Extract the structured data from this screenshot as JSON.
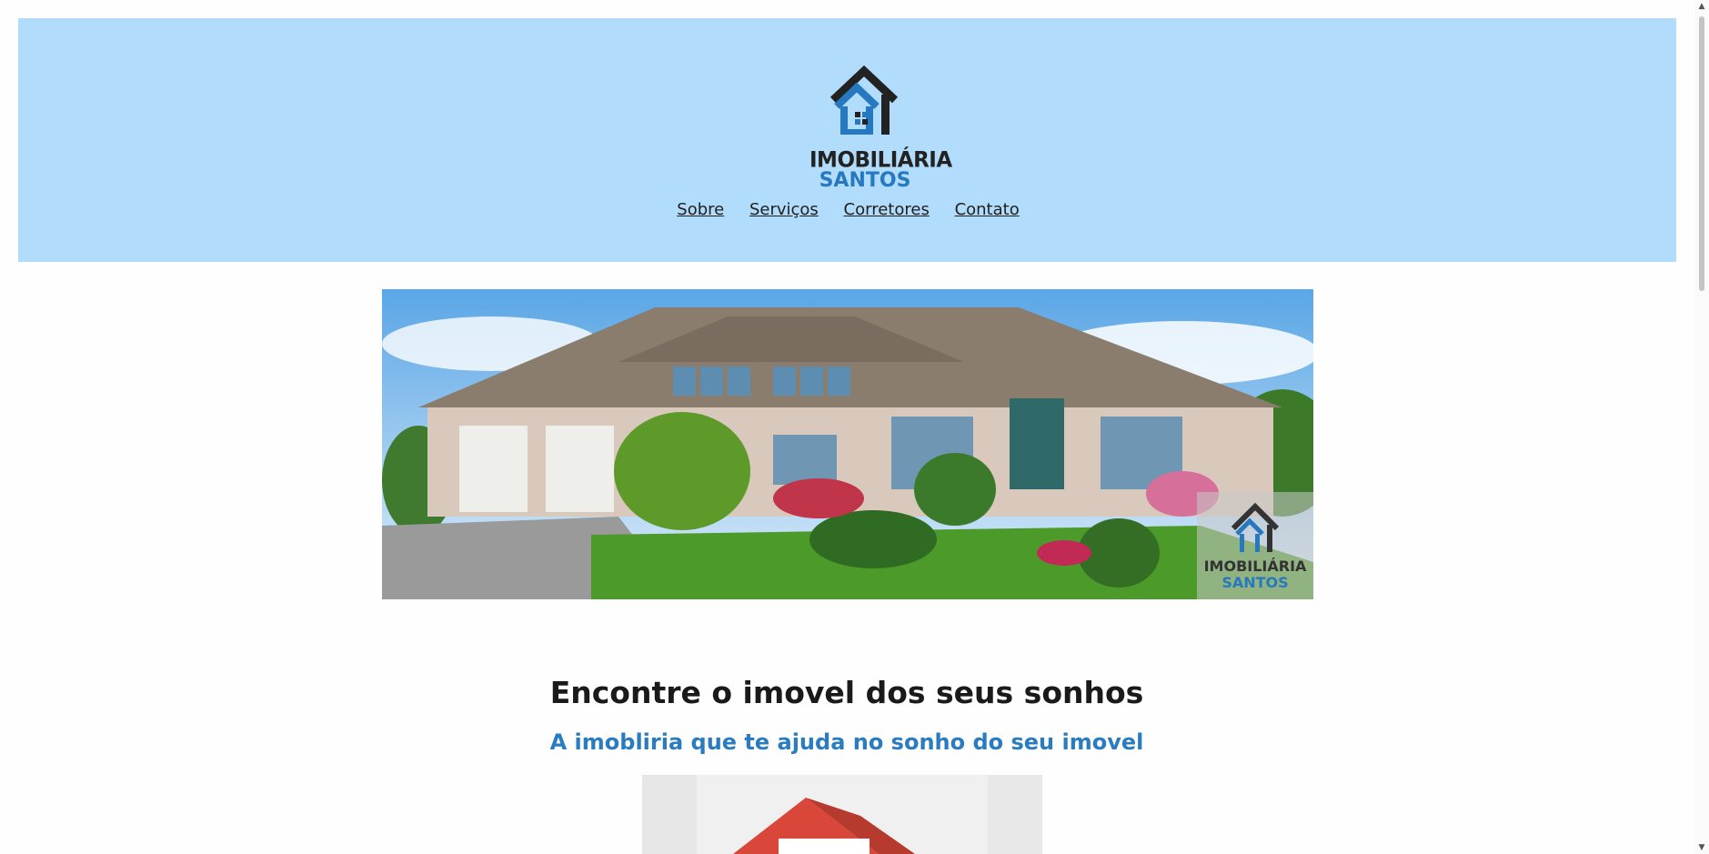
{
  "brand": {
    "line1": "IMOBILIÁRIA",
    "line2": "SANTOS",
    "colors": {
      "header_bg": "#b1dcfc",
      "accent_blue": "#2679bf",
      "dark": "#222222"
    }
  },
  "nav": {
    "items": [
      {
        "label": "Sobre"
      },
      {
        "label": "Serviços"
      },
      {
        "label": "Corretores"
      },
      {
        "label": "Contato"
      }
    ]
  },
  "hero": {
    "watermark_line1": "IMOBILIÁRIA",
    "watermark_line2": "SANTOS"
  },
  "content": {
    "headline": "Encontre o imovel dos seus sonhos",
    "subheadline": "A imobliria que te ajuda no sonho do seu imovel"
  },
  "icons": [
    "house-logo-icon",
    "scroll-up-arrow-icon",
    "scroll-down-arrow-icon"
  ]
}
